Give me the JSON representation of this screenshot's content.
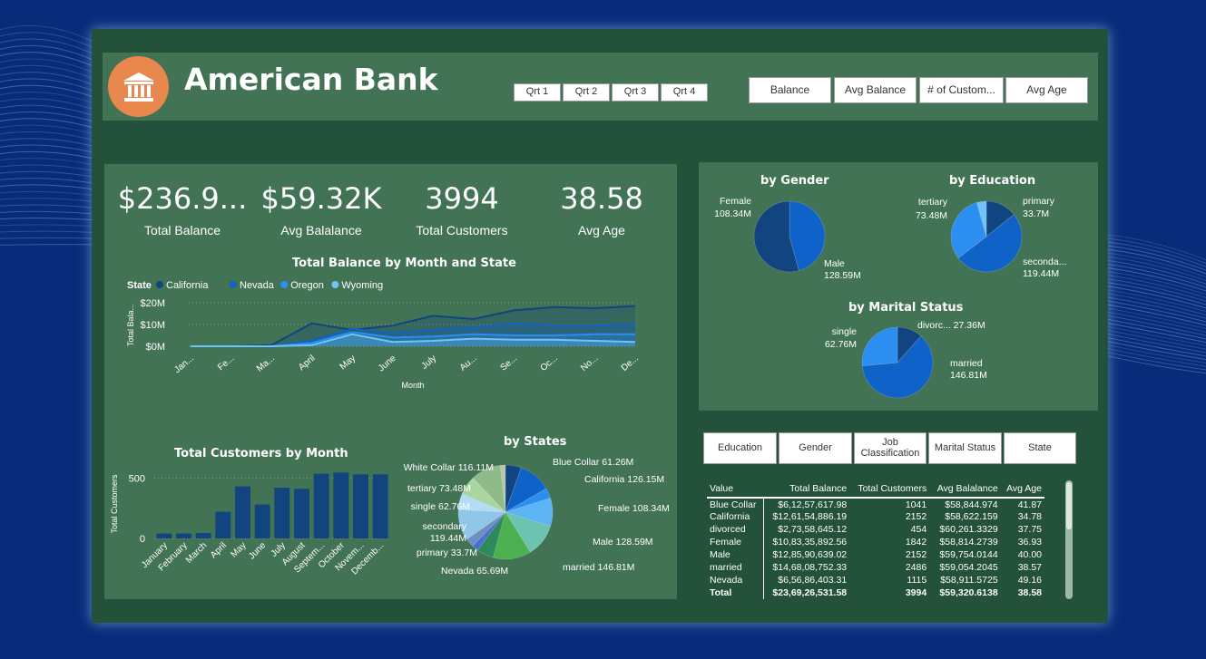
{
  "header": {
    "title": "American Bank",
    "quarters": [
      "Qrt 1",
      "Qrt 2",
      "Qrt 3",
      "Qrt 4"
    ],
    "measures": [
      "Balance",
      "Avg Balance",
      "# of Custom...",
      "Avg Age"
    ]
  },
  "kpis": [
    {
      "value": "$236.9...",
      "label": "Total Balance"
    },
    {
      "value": "$59.32K",
      "label": "Avg Balalance"
    },
    {
      "value": "3994",
      "label": "Total Customers"
    },
    {
      "value": "38.58",
      "label": "Avg Age"
    }
  ],
  "slicers": [
    "Education",
    "Gender",
    "Job Classification",
    "Marital Status",
    "State"
  ],
  "colors": {
    "background": "#0a2a7a",
    "dashboard": "#24513a",
    "logo": "#e8884f",
    "california": "#12447f",
    "nevada": "#0f62c7",
    "oregon": "#2b8ef0",
    "wyoming": "#6ec4f7"
  },
  "logo_icon": "bank-icon",
  "chart_data": [
    {
      "id": "balance_line",
      "type": "area",
      "title": "Total Balance by Month and State",
      "xlabel": "Month",
      "ylabel": "Total Bala...",
      "legend_title": "State",
      "legend_position": "top-left",
      "categories": [
        "Jan...",
        "Fe...",
        "Ma...",
        "April",
        "May",
        "June",
        "July",
        "Au...",
        "Se...",
        "Oc...",
        "No...",
        "De..."
      ],
      "yticks": [
        "$20M",
        "$10M",
        "$0M"
      ],
      "ylim": [
        0,
        20
      ],
      "series": [
        {
          "name": "California",
          "values": [
            0,
            0,
            0.5,
            10.5,
            7.5,
            9.5,
            14,
            12.5,
            16.5,
            18,
            17.5,
            18.5
          ]
        },
        {
          "name": "Nevada",
          "values": [
            0,
            0,
            0,
            2.5,
            8,
            6,
            7.5,
            8.5,
            10.5,
            9.5,
            9.5,
            10
          ]
        },
        {
          "name": "Oregon",
          "values": [
            0,
            0,
            0,
            1.5,
            6.5,
            4,
            4.5,
            5.5,
            5,
            5,
            5.5,
            5.5
          ]
        },
        {
          "name": "Wyoming",
          "values": [
            0,
            0,
            0,
            0.5,
            5.5,
            2,
            2.5,
            3.5,
            3,
            3,
            2.5,
            2
          ]
        }
      ],
      "grid": true
    },
    {
      "id": "customers_bar",
      "type": "bar",
      "title": "Total Customers by Month",
      "xlabel": "",
      "ylabel": "Total Customers",
      "categories": [
        "January",
        "February",
        "March",
        "April",
        "May",
        "June",
        "July",
        "August",
        "Septem...",
        "October",
        "Novem...",
        "Decemb..."
      ],
      "values": [
        40,
        40,
        45,
        220,
        430,
        280,
        420,
        410,
        535,
        545,
        530,
        530
      ],
      "yticks": [
        "500",
        "0"
      ],
      "ylim": [
        0,
        600
      ],
      "grid": true
    },
    {
      "id": "gender_pie",
      "type": "pie",
      "title": "by Gender",
      "slices": [
        {
          "label": "Female",
          "value": 108.34,
          "text": "108.34M",
          "color": "#0f62c7"
        },
        {
          "label": "Male",
          "value": 128.59,
          "text": "128.59M",
          "color": "#12447f"
        }
      ]
    },
    {
      "id": "education_pie",
      "type": "pie",
      "title": "by Education",
      "slices": [
        {
          "label": "primary",
          "value": 33.7,
          "text": "33.7M",
          "color": "#12447f"
        },
        {
          "label": "seconda...",
          "value": 119.44,
          "text": "119.44M",
          "color": "#0f62c7"
        },
        {
          "label": "tertiary",
          "value": 73.48,
          "text": "73.48M",
          "color": "#2b8ef0"
        },
        {
          "label": "",
          "value": 10.3,
          "text": "",
          "color": "#6ec4f7"
        }
      ]
    },
    {
      "id": "marital_pie",
      "type": "pie",
      "title": "by Marital Status",
      "slices": [
        {
          "label": "divorc...",
          "value": 27.36,
          "text": "27.36M",
          "color": "#12447f"
        },
        {
          "label": "married",
          "value": 146.81,
          "text": "146.81M",
          "color": "#0f62c7"
        },
        {
          "label": "single",
          "value": 62.76,
          "text": "62.76M",
          "color": "#2b8ef0"
        }
      ]
    },
    {
      "id": "states_pie",
      "type": "pie",
      "title": "by States",
      "slices": [
        {
          "label": "Blue Collar",
          "value": 61.26,
          "text": "61.26M",
          "color": "#12447f"
        },
        {
          "label": "California",
          "value": 126.15,
          "text": "126.15M",
          "color": "#0f62c7"
        },
        {
          "label": "",
          "value": 40,
          "text": "",
          "color": "#2b8ef0"
        },
        {
          "label": "Female",
          "value": 108.34,
          "text": "108.34M",
          "color": "#5cb4f5"
        },
        {
          "label": "Male",
          "value": 128.59,
          "text": "128.59M",
          "color": "#6cc3b0"
        },
        {
          "label": "married",
          "value": 146.81,
          "text": "146.81M",
          "color": "#4caf50"
        },
        {
          "label": "Nevada",
          "value": 65.69,
          "text": "65.69M",
          "color": "#2e8a5a"
        },
        {
          "label": "",
          "value": 25,
          "text": "",
          "color": "#4a6fd1"
        },
        {
          "label": "primary",
          "value": 33.7,
          "text": "33.7M",
          "color": "#6b8fbf"
        },
        {
          "label": "secondary",
          "value": 119.44,
          "text": "119.44M",
          "color": "#8fc6ea"
        },
        {
          "label": "single",
          "value": 62.76,
          "text": "62.76M",
          "color": "#b3dcf5"
        },
        {
          "label": "tertiary",
          "value": 73.48,
          "text": "73.48M",
          "color": "#a9d6a0"
        },
        {
          "label": "White Collar",
          "value": 116.11,
          "text": "116.11M",
          "color": "#8fba8a"
        },
        {
          "label": "",
          "value": 20,
          "text": "",
          "color": "#b7c9a8"
        }
      ]
    },
    {
      "id": "summary_table",
      "type": "table",
      "columns": [
        "Value",
        "Total Balance",
        "Total Customers",
        "Avg Balalance",
        "Avg Age"
      ],
      "rows": [
        [
          "Blue Collar",
          "$6,12,57,617.98",
          "1041",
          "$58,844.974",
          "41.87"
        ],
        [
          "California",
          "$12,61,54,886.19",
          "2152",
          "$58,622.159",
          "34.78"
        ],
        [
          "divorced",
          "$2,73,58,645.12",
          "454",
          "$60,261.3329",
          "37.75"
        ],
        [
          "Female",
          "$10,83,35,892.56",
          "1842",
          "$58,814.2739",
          "36.93"
        ],
        [
          "Male",
          "$12,85,90,639.02",
          "2152",
          "$59,754.0144",
          "40.00"
        ],
        [
          "married",
          "$14,68,08,752.33",
          "2486",
          "$59,054.2045",
          "38.57"
        ],
        [
          "Nevada",
          "$6,56,86,403.31",
          "1115",
          "$58,911.5725",
          "49.16"
        ]
      ],
      "total": [
        "Total",
        "$23,69,26,531.58",
        "3994",
        "$59,320.6138",
        "38.58"
      ]
    }
  ]
}
